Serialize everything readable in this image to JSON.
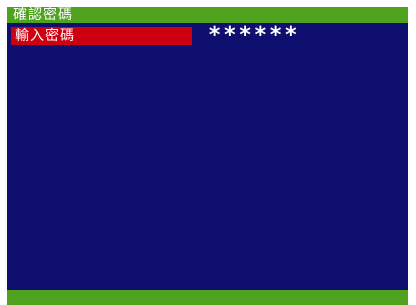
{
  "title_bar": {
    "title": "確認密碼"
  },
  "password_row": {
    "label": "輸入密碼",
    "value": "******"
  },
  "colors": {
    "background": "#0e0f6e",
    "bar_green": "#4fa21e",
    "highlight_red": "#cc0010",
    "text": "#ffffff"
  }
}
